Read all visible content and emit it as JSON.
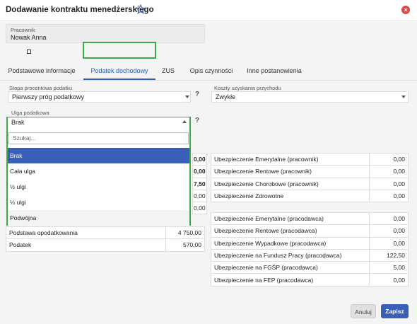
{
  "header": {
    "title": "Dodawanie kontraktu menedżerskiego"
  },
  "employee": {
    "label": "Pracownik",
    "value": "Nowak Anna"
  },
  "tabs": [
    {
      "label": "Podstawowe informacje"
    },
    {
      "label": "Podatek dochodowy"
    },
    {
      "label": "ZUS"
    },
    {
      "label": "Opis czynności"
    },
    {
      "label": "Inne postanowienia"
    }
  ],
  "active_tab": "Podatek dochodowy",
  "tax_rate": {
    "label": "Stopa procentowa podatku",
    "value": "Pierwszy próg podatkowy",
    "help": "?"
  },
  "costs": {
    "label": "Koszty uzyskania przychodu",
    "value": "Zwykłe"
  },
  "relief": {
    "label": "Ulga podatkowa",
    "value": "Brak",
    "help": "?"
  },
  "dropdown": {
    "search_placeholder": "Szukaj...",
    "options": [
      "Brak",
      "Cała ulga",
      "½ ulgi",
      "⅓ ulgi",
      "Podwójna"
    ],
    "selected": "Brak"
  },
  "left_table": {
    "partial_values": [
      "0,00",
      "0,00",
      "7,50",
      "0,00",
      "0,00"
    ],
    "rows": [
      {
        "label": "Podstawa opodatkowania",
        "value": "4 750,00"
      },
      {
        "label": "Podatek",
        "value": "570,00"
      }
    ]
  },
  "right_table_1": {
    "rows": [
      {
        "label": "Ubezpieczenie Emerytalne (pracownik)",
        "value": "0,00"
      },
      {
        "label": "Ubezpieczenie Rentowe (pracownik)",
        "value": "0,00"
      },
      {
        "label": "Ubezpieczenie Chorobowe (pracownik)",
        "value": "0,00"
      },
      {
        "label": "Ubezpieczenie Zdrowotne",
        "value": "0,00"
      }
    ]
  },
  "right_table_2": {
    "rows": [
      {
        "label": "Ubezpieczenie Emerytalne (pracodawca)",
        "value": "0,00"
      },
      {
        "label": "Ubezpieczenie Rentowe (pracodawca)",
        "value": "0,00"
      },
      {
        "label": "Ubezpieczenie Wypadkowe (pracodawca)",
        "value": "0,00"
      },
      {
        "label": "Ubezpieczenie na Fundusz Pracy (pracodawca)",
        "value": "122,50"
      },
      {
        "label": "Ubezpieczenie na FGŚP (pracodawca)",
        "value": "5,00"
      },
      {
        "label": "Ubezpieczenie na FEP (pracodawca)",
        "value": "0,00"
      }
    ]
  },
  "buttons": {
    "cancel": "Anuluj",
    "save": "Zapisz"
  },
  "colors": {
    "accent": "#3a5fb8",
    "highlight": "#3aaa44",
    "close": "#e04848"
  }
}
